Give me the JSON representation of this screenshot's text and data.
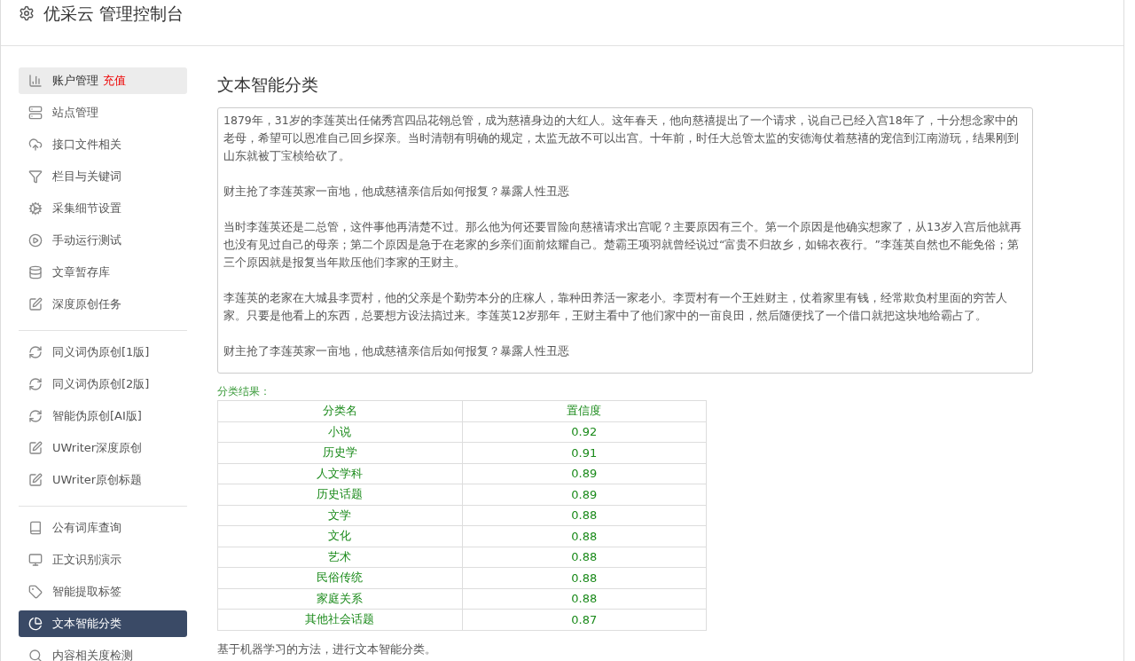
{
  "header": {
    "title": "优采云 管理控制台"
  },
  "sidebar": {
    "groups": [
      {
        "items": [
          {
            "label": "账户管理",
            "badge": "充值",
            "selected": false,
            "highlighted": true
          },
          {
            "label": "站点管理",
            "selected": false,
            "highlighted": false
          },
          {
            "label": "接口文件相关",
            "selected": false,
            "highlighted": false
          },
          {
            "label": "栏目与关键词",
            "selected": false,
            "highlighted": false
          },
          {
            "label": "采集细节设置",
            "selected": false,
            "highlighted": false
          },
          {
            "label": "手动运行测试",
            "selected": false,
            "highlighted": false
          },
          {
            "label": "文章暂存库",
            "selected": false,
            "highlighted": false
          },
          {
            "label": "深度原创任务",
            "selected": false,
            "highlighted": false
          }
        ]
      },
      {
        "items": [
          {
            "label": "同义词伪原创[1版]",
            "selected": false,
            "highlighted": false
          },
          {
            "label": "同义词伪原创[2版]",
            "selected": false,
            "highlighted": false
          },
          {
            "label": "智能伪原创[AI版]",
            "selected": false,
            "highlighted": false
          },
          {
            "label": "UWriter深度原创",
            "selected": false,
            "highlighted": false
          },
          {
            "label": "UWriter原创标题",
            "selected": false,
            "highlighted": false
          }
        ]
      },
      {
        "items": [
          {
            "label": "公有词库查询",
            "selected": false,
            "highlighted": false
          },
          {
            "label": "正文识别演示",
            "selected": false,
            "highlighted": false
          },
          {
            "label": "智能提取标签",
            "selected": false,
            "highlighted": false
          },
          {
            "label": "文本智能分类",
            "selected": true,
            "highlighted": false
          },
          {
            "label": "内容相关度检测",
            "selected": false,
            "highlighted": false
          }
        ]
      }
    ]
  },
  "main": {
    "title": "文本智能分类",
    "input_text": [
      "1879年，31岁的李莲英出任储秀宫四品花翎总管，成为慈禧身边的大红人。这年春天，他向慈禧提出了一个请求，说自己已经入宫18年了，十分想念家中的老母，希望可以恩准自己回乡探亲。当时清朝有明确的规定，太监无故不可以出宫。十年前，时任大总管太监的安德海仗着慈禧的宠信到江南游玩，结果刚到山东就被丁宝桢给砍了。",
      "财主抢了李莲英家一亩地，他成慈禧亲信后如何报复？暴露人性丑恶",
      "当时李莲英还是二总管，这件事他再清楚不过。那么他为何还要冒险向慈禧请求出宫呢？主要原因有三个。第一个原因是他确实想家了，从13岁入宫后他就再也没有见过自己的母亲；第二个原因是急于在老家的乡亲们面前炫耀自己。楚霸王项羽就曾经说过“富贵不归故乡，如锦衣夜行。”李莲英自然也不能免俗；第三个原因就是报复当年欺压他们李家的王财主。",
      "李莲英的老家在大城县李贾村，他的父亲是个勤劳本分的庄稼人，靠种田养活一家老小。李贾村有一个王姓财主，仗着家里有钱，经常欺负村里面的穷苦人家。只要是他看上的东西，总要想方设法搞过来。李莲英12岁那年，王财主看中了他们家中的一亩良田，然后随便找了一个借口就把这块地给霸占了。",
      "财主抢了李莲英家一亩地，他成慈禧亲信后如何报复？暴露人性丑恶"
    ],
    "result_label": "分类结果：",
    "table": {
      "columns": [
        "分类名",
        "置信度"
      ],
      "rows": [
        [
          "小说",
          "0.92"
        ],
        [
          "历史学",
          "0.91"
        ],
        [
          "人文学科",
          "0.89"
        ],
        [
          "历史话题",
          "0.89"
        ],
        [
          "文学",
          "0.88"
        ],
        [
          "文化",
          "0.88"
        ],
        [
          "艺术",
          "0.88"
        ],
        [
          "民俗传统",
          "0.88"
        ],
        [
          "家庭关系",
          "0.88"
        ],
        [
          "其他社会话题",
          "0.87"
        ]
      ]
    },
    "note": "基于机器学习的方法，进行文本智能分类。"
  }
}
